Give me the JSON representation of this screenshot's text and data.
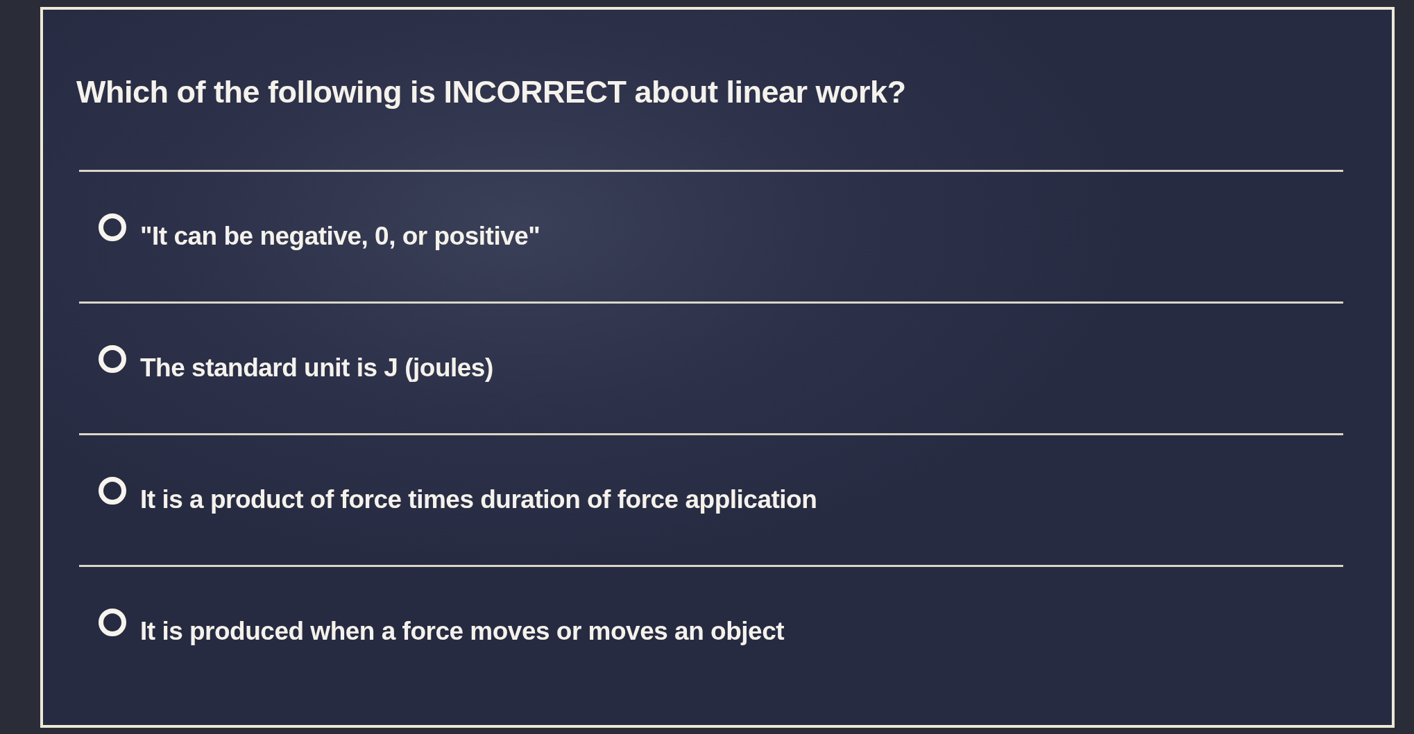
{
  "question": {
    "text": "Which of the following is INCORRECT about linear work?"
  },
  "options": [
    {
      "label": "\"It can be negative, 0, or positive\"",
      "selected": false
    },
    {
      "label": "The standard unit is J (joules)",
      "selected": false
    },
    {
      "label": "It is a product of force times duration of force application",
      "selected": false
    },
    {
      "label": "It is produced when a force moves or moves an object",
      "selected": false
    }
  ]
}
